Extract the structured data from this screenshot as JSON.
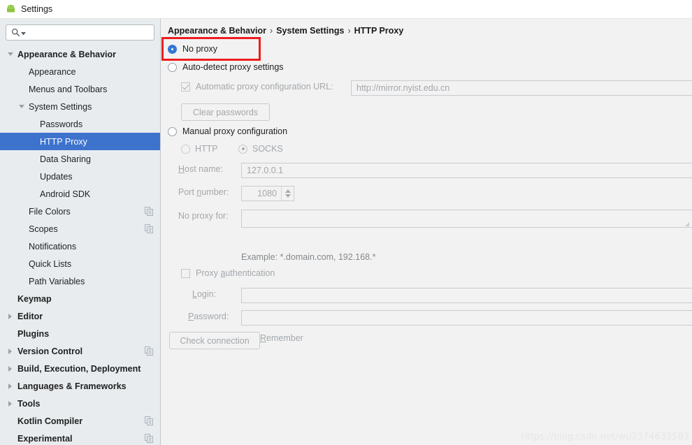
{
  "window": {
    "title": "Settings",
    "icon": "android-icon"
  },
  "sidebar": {
    "search": {
      "value": "",
      "placeholder": "",
      "icon": "search-icon",
      "dropdown_icon": "chevron-down-icon"
    },
    "items": [
      {
        "label": "Appearance & Behavior",
        "indent": 0,
        "bold": true,
        "twisty": "down",
        "selected": false,
        "copy": false
      },
      {
        "label": "Appearance",
        "indent": 1,
        "bold": false,
        "twisty": "none",
        "selected": false,
        "copy": false
      },
      {
        "label": "Menus and Toolbars",
        "indent": 1,
        "bold": false,
        "twisty": "none",
        "selected": false,
        "copy": false
      },
      {
        "label": "System Settings",
        "indent": 1,
        "bold": false,
        "twisty": "down",
        "selected": false,
        "copy": false
      },
      {
        "label": "Passwords",
        "indent": 2,
        "bold": false,
        "twisty": "none",
        "selected": false,
        "copy": false
      },
      {
        "label": "HTTP Proxy",
        "indent": 2,
        "bold": false,
        "twisty": "none",
        "selected": true,
        "copy": false
      },
      {
        "label": "Data Sharing",
        "indent": 2,
        "bold": false,
        "twisty": "none",
        "selected": false,
        "copy": false
      },
      {
        "label": "Updates",
        "indent": 2,
        "bold": false,
        "twisty": "none",
        "selected": false,
        "copy": false
      },
      {
        "label": "Android SDK",
        "indent": 2,
        "bold": false,
        "twisty": "none",
        "selected": false,
        "copy": false
      },
      {
        "label": "File Colors",
        "indent": 1,
        "bold": false,
        "twisty": "none",
        "selected": false,
        "copy": true
      },
      {
        "label": "Scopes",
        "indent": 1,
        "bold": false,
        "twisty": "none",
        "selected": false,
        "copy": true
      },
      {
        "label": "Notifications",
        "indent": 1,
        "bold": false,
        "twisty": "none",
        "selected": false,
        "copy": false
      },
      {
        "label": "Quick Lists",
        "indent": 1,
        "bold": false,
        "twisty": "none",
        "selected": false,
        "copy": false
      },
      {
        "label": "Path Variables",
        "indent": 1,
        "bold": false,
        "twisty": "none",
        "selected": false,
        "copy": false
      },
      {
        "label": "Keymap",
        "indent": 0,
        "bold": true,
        "twisty": "none",
        "selected": false,
        "copy": false
      },
      {
        "label": "Editor",
        "indent": 0,
        "bold": true,
        "twisty": "right",
        "selected": false,
        "copy": false
      },
      {
        "label": "Plugins",
        "indent": 0,
        "bold": true,
        "twisty": "none",
        "selected": false,
        "copy": false
      },
      {
        "label": "Version Control",
        "indent": 0,
        "bold": true,
        "twisty": "right",
        "selected": false,
        "copy": true
      },
      {
        "label": "Build, Execution, Deployment",
        "indent": 0,
        "bold": true,
        "twisty": "right",
        "selected": false,
        "copy": false
      },
      {
        "label": "Languages & Frameworks",
        "indent": 0,
        "bold": true,
        "twisty": "right",
        "selected": false,
        "copy": false
      },
      {
        "label": "Tools",
        "indent": 0,
        "bold": true,
        "twisty": "right",
        "selected": false,
        "copy": false
      },
      {
        "label": "Kotlin Compiler",
        "indent": 0,
        "bold": true,
        "twisty": "none",
        "selected": false,
        "copy": true
      },
      {
        "label": "Experimental",
        "indent": 0,
        "bold": true,
        "twisty": "none",
        "selected": false,
        "copy": true
      }
    ]
  },
  "main": {
    "breadcrumb": {
      "part1": "Appearance & Behavior",
      "sep1": "›",
      "part2": "System Settings",
      "sep2": "›",
      "part3": "HTTP Proxy"
    },
    "no_proxy": {
      "label": "No proxy",
      "checked": true
    },
    "auto_detect": {
      "label": "Auto-detect proxy settings",
      "checked": false
    },
    "auto_url_checkbox": {
      "label": "Automatic proxy configuration URL:",
      "checked": true,
      "disabled": true
    },
    "auto_url_field": {
      "value": "http://mirror.nyist.edu.cn"
    },
    "clear_passwords_button": {
      "label": "Clear passwords"
    },
    "manual_proxy": {
      "label": "Manual proxy configuration",
      "checked": false
    },
    "http_radio": {
      "label": "HTTP",
      "checked": false
    },
    "socks_radio": {
      "label": "SOCKS",
      "checked": true
    },
    "host_name": {
      "label_mnemonic": "H",
      "label_rest": "ost name:",
      "value": "127.0.0.1"
    },
    "port_number": {
      "label_pre": "Port ",
      "label_mnemonic": "n",
      "label_rest": "umber:",
      "value": "1080"
    },
    "no_proxy_for": {
      "label": "No proxy for:",
      "value": ""
    },
    "example_hint": "Example: *.domain.com, 192.168.*",
    "proxy_auth": {
      "label_pre": "Proxy ",
      "label_mnemonic": "a",
      "label_rest": "uthentication",
      "checked": false
    },
    "login": {
      "label_mnemonic": "L",
      "label_rest": "ogin:",
      "value": ""
    },
    "password": {
      "label_mnemonic": "P",
      "label_rest": "assword:",
      "value": ""
    },
    "remember": {
      "label_mnemonic": "R",
      "label_rest": "emember",
      "checked": false
    },
    "check_connection_button": {
      "label": "Check connection"
    },
    "highlight_color": "#ee1d1d"
  },
  "watermark": {
    "text": "https://blog.csdn.net/wu2374633583"
  }
}
